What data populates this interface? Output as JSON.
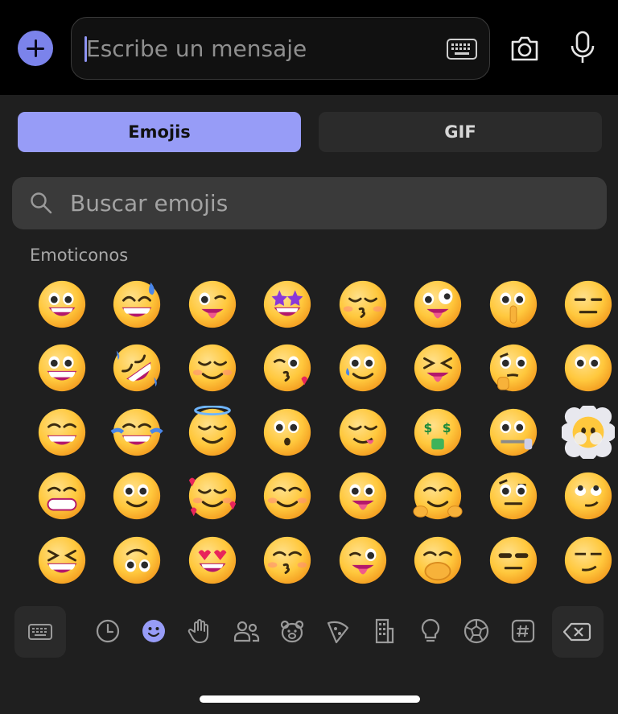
{
  "composer": {
    "placeholder": "Escribe un mensaje",
    "add_icon": "plus-icon",
    "keyboard_icon": "keyboard-icon",
    "camera_icon": "camera-icon",
    "mic_icon": "microphone-icon"
  },
  "tabs": [
    {
      "label": "Emojis",
      "selected": true
    },
    {
      "label": "GIF",
      "selected": false
    }
  ],
  "search": {
    "placeholder": "Buscar emojis",
    "icon": "search-icon"
  },
  "section_title": "Emoticonos",
  "emojis": [
    "grinning-face",
    "grinning-face-with-sweat",
    "winking-face-with-tongue",
    "star-struck",
    "kissing-face-with-smiling-eyes",
    "zany-face",
    "shushing-face",
    "expressionless-face",
    "grinning-face-big-eyes",
    "rolling-on-the-floor-laughing",
    "smiling-face",
    "face-blowing-kiss",
    "smiling-face-with-tear",
    "squinting-face-with-tongue",
    "thinking-face",
    "face-with-open-eyes",
    "grinning-face-with-smiling-eyes",
    "face-with-tears-of-joy",
    "smiling-face-with-halo",
    "kissing-face",
    "face-savoring-food",
    "money-mouth-face",
    "zipper-mouth-face",
    "face-in-clouds",
    "beaming-face",
    "slightly-smiling-face",
    "smiling-face-with-hearts",
    "smiling-face-with-smiling-eyes",
    "face-with-tongue",
    "hugging-face",
    "face-with-raised-eyebrow",
    "face-with-rolling-eyes-smirk",
    "grinning-squinting-face",
    "upside-down-face",
    "smiling-face-with-heart-eyes",
    "kissing-face-closed-eyes",
    "winking-face",
    "face-with-hand-over-mouth",
    "neutral-face",
    "smirking-face"
  ],
  "categories": [
    {
      "name": "recent",
      "icon": "clock-icon",
      "active": false
    },
    {
      "name": "smileys",
      "icon": "smiley-icon",
      "active": true
    },
    {
      "name": "gestures",
      "icon": "hand-icon",
      "active": false
    },
    {
      "name": "people",
      "icon": "people-icon",
      "active": false
    },
    {
      "name": "animals",
      "icon": "bear-icon",
      "active": false
    },
    {
      "name": "food",
      "icon": "pizza-icon",
      "active": false
    },
    {
      "name": "places",
      "icon": "building-icon",
      "active": false
    },
    {
      "name": "objects",
      "icon": "lightbulb-icon",
      "active": false
    },
    {
      "name": "activities",
      "icon": "soccer-ball-icon",
      "active": false
    },
    {
      "name": "symbols",
      "icon": "hashtag-icon",
      "active": false
    }
  ],
  "bottom": {
    "keyboard_icon": "keyboard-icon",
    "delete_icon": "backspace-icon"
  },
  "colors": {
    "accent": "#979cf7",
    "accent_icon": "#7b83eb",
    "background": "#1f1f1f",
    "emoji_face": "#ffc83d"
  }
}
